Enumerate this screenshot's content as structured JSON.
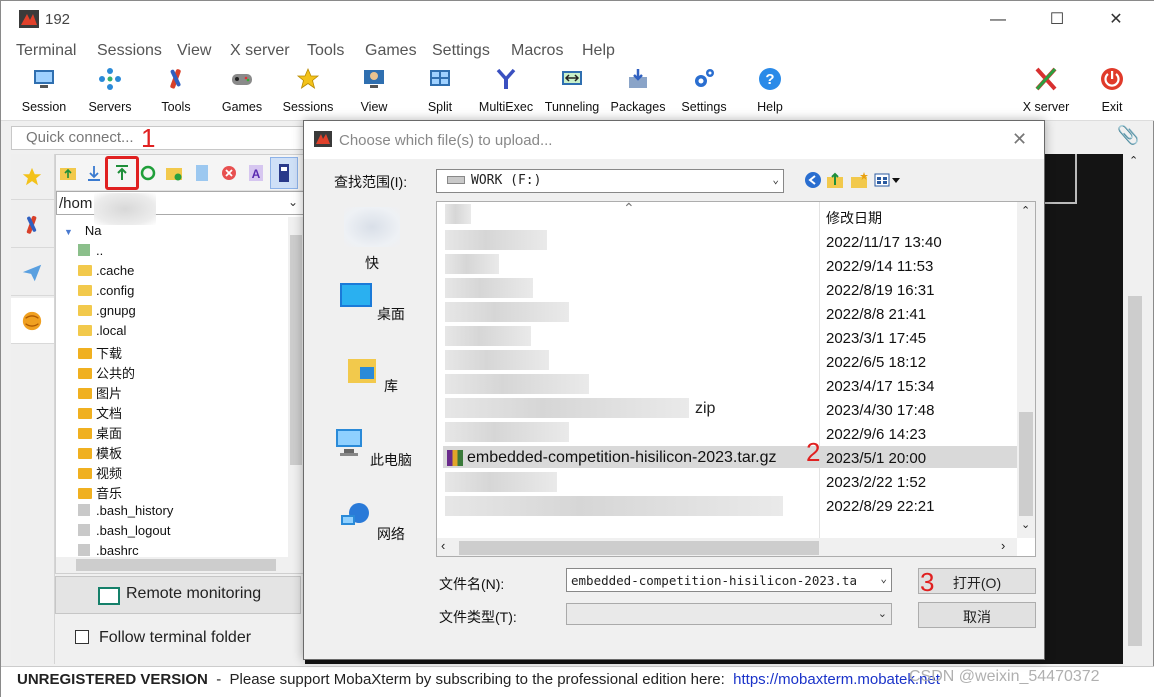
{
  "window": {
    "title": "192"
  },
  "menu": [
    "Terminal",
    "Sessions",
    "View",
    "X server",
    "Tools",
    "Games",
    "Settings",
    "Macros",
    "Help"
  ],
  "toolbar": [
    {
      "label": "Session",
      "icon": "session-icon"
    },
    {
      "label": "Servers",
      "icon": "servers-icon"
    },
    {
      "label": "Tools",
      "icon": "tools-icon"
    },
    {
      "label": "Games",
      "icon": "games-icon"
    },
    {
      "label": "Sessions",
      "icon": "star-icon"
    },
    {
      "label": "View",
      "icon": "view-icon"
    },
    {
      "label": "Split",
      "icon": "split-icon"
    },
    {
      "label": "MultiExec",
      "icon": "multiexec-icon"
    },
    {
      "label": "Tunneling",
      "icon": "tunneling-icon"
    },
    {
      "label": "Packages",
      "icon": "packages-icon"
    },
    {
      "label": "Settings",
      "icon": "gear-icon"
    },
    {
      "label": "Help",
      "icon": "help-icon"
    }
  ],
  "toolbar_right": [
    {
      "label": "X server",
      "icon": "xserver-icon"
    },
    {
      "label": "Exit",
      "icon": "power-icon"
    }
  ],
  "quick_connect": {
    "placeholder": "Quick connect..."
  },
  "sftp": {
    "path": "/hom",
    "name_header": "Na",
    "items": [
      {
        "name": "..",
        "kind": "up"
      },
      {
        "name": ".cache",
        "kind": "folder"
      },
      {
        "name": ".config",
        "kind": "folder"
      },
      {
        "name": ".gnupg",
        "kind": "folder"
      },
      {
        "name": ".local",
        "kind": "folder"
      },
      {
        "name": "下载",
        "kind": "folder"
      },
      {
        "name": "公共的",
        "kind": "folder"
      },
      {
        "name": "图片",
        "kind": "folder"
      },
      {
        "name": "文档",
        "kind": "folder"
      },
      {
        "name": "桌面",
        "kind": "folder"
      },
      {
        "name": "模板",
        "kind": "folder"
      },
      {
        "name": "视频",
        "kind": "folder"
      },
      {
        "name": "音乐",
        "kind": "folder"
      },
      {
        "name": ".bash_history",
        "kind": "file"
      },
      {
        "name": ".bash_logout",
        "kind": "file"
      },
      {
        "name": ".bashrc",
        "kind": "file"
      }
    ],
    "remote_monitoring": "Remote monitoring",
    "follow_terminal": "Follow terminal folder"
  },
  "dialog": {
    "title": "Choose which file(s) to upload...",
    "look_in_label": "查找范围(I):",
    "look_in_value": "WORK (F:)",
    "places": [
      "快",
      "桌面",
      "库",
      "此电脑",
      "网络"
    ],
    "date_header": "修改日期",
    "dates": [
      "2022/11/17 13:40",
      "2022/9/14 11:53",
      "2022/8/19 16:31",
      "2022/8/8 21:41",
      "2023/3/1 17:45",
      "2022/6/5 18:12",
      "2023/4/17 15:34",
      "2023/4/30 17:48",
      "2022/9/6 14:23",
      "2023/5/1 20:00",
      "2023/2/22 1:52",
      "2022/8/29 22:21"
    ],
    "selected_file": "embedded-competition-hisilicon-2023.tar.gz",
    "zip_fragment": "zip",
    "file_name_label": "文件名(N):",
    "file_name_value": "embedded-competition-hisilicon-2023.ta",
    "file_type_label": "文件类型(T):",
    "open_label": "打开(O)",
    "cancel_label": "取消"
  },
  "annotations": [
    "1",
    "2",
    "3"
  ],
  "status": {
    "unregistered": "UNREGISTERED VERSION",
    "message": "  -  Please support MobaXterm by subscribing to the professional edition here:  ",
    "link": "https://mobaxterm.mobatek.net",
    "watermark": "CSDN @weixin_54470372"
  },
  "colors": {
    "annotation": "#e02020",
    "terminal_bg": "#141414",
    "link": "#1a33c9"
  }
}
